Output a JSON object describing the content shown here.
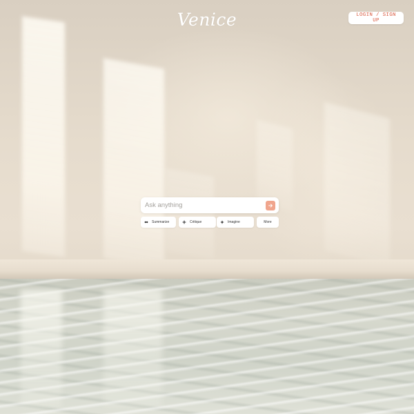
{
  "header": {
    "logo_text": "Venice",
    "login_label": "LOGIN / SIGN UP"
  },
  "search": {
    "placeholder": "Ask anything",
    "value": "",
    "send_icon": "arrow-right-icon"
  },
  "chips": [
    {
      "label": "Summarize",
      "icon": "summarize-icon"
    },
    {
      "label": "Critique",
      "icon": "plus-icon"
    },
    {
      "label": "Imagine",
      "icon": "sparkle-icon"
    },
    {
      "label": "More"
    }
  ],
  "colors": {
    "accent": "#d95a3f",
    "send_button": "#f0a58d",
    "card": "#ffffff"
  }
}
